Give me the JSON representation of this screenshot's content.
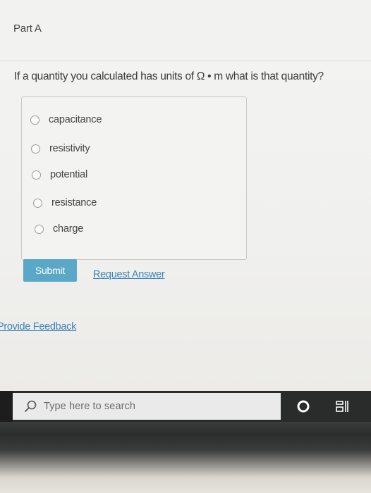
{
  "part": {
    "title": "Part A"
  },
  "question": {
    "text": "If a quantity you calculated has units of Ω • m what is that quantity?"
  },
  "choices": [
    {
      "label": "capacitance"
    },
    {
      "label": "resistivity"
    },
    {
      "label": "potential"
    },
    {
      "label": "resistance"
    },
    {
      "label": "charge"
    }
  ],
  "actions": {
    "submit_label": "Submit",
    "request_answer_label": "Request Answer",
    "feedback_label": "Provide Feedback"
  },
  "taskbar": {
    "search_placeholder": "Type here to search",
    "search_icon": "search-icon",
    "cortana_icon": "cortana-icon",
    "taskview_icon": "task-view-icon"
  },
  "colors": {
    "submit_bg": "#5aa7c8",
    "link": "#3d83b8",
    "taskbar": "#2a2c2b"
  }
}
